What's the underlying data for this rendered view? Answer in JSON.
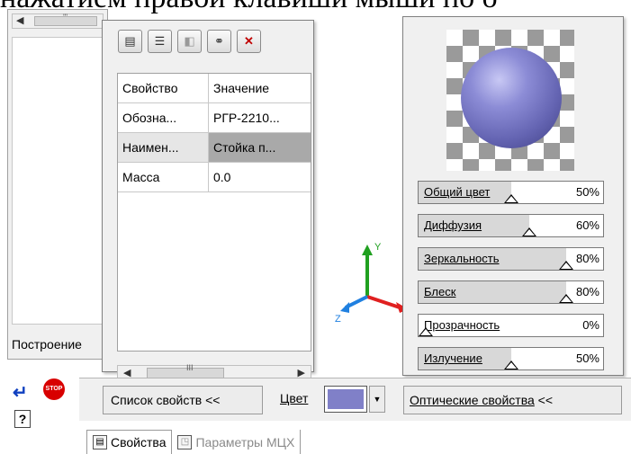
{
  "heading": "нажатием правой клавиши мыши по о",
  "left_panel": {
    "label": "Построение",
    "scroll_grip": "'''"
  },
  "props_panel": {
    "toolbar": [
      {
        "name": "properties-sheet-icon",
        "glyph": "▤"
      },
      {
        "name": "list-icon",
        "glyph": "☰"
      },
      {
        "name": "library-icon",
        "glyph": "◧"
      },
      {
        "name": "link-icon",
        "glyph": "⚭"
      },
      {
        "name": "delete-icon",
        "glyph": "✕"
      }
    ],
    "header": {
      "key": "Свойство",
      "value": "Значение"
    },
    "rows": [
      {
        "key": "Обозна...",
        "value": "РГР-2210..."
      },
      {
        "key": "Наимен...",
        "value": "Стойка п..."
      },
      {
        "key": "Масса",
        "value": "0.0"
      }
    ],
    "scroll_grip": "III"
  },
  "optics_panel": {
    "sliders": [
      {
        "label": "Общий цвет",
        "value": "50%",
        "level": 0.5
      },
      {
        "label": "Диффузия",
        "value": "60%",
        "level": 0.6
      },
      {
        "label": "Зеркальность",
        "value": "80%",
        "level": 0.8
      },
      {
        "label": "Блеск",
        "value": "80%",
        "level": 0.8
      },
      {
        "label": "Прозрачность",
        "value": "0%",
        "level": 0.0
      },
      {
        "label": "Излучение",
        "value": "50%",
        "level": 0.5
      }
    ]
  },
  "axes": {
    "y": "Y",
    "z": "Z"
  },
  "bottom_bar": {
    "list_button": "Список свойств  <<",
    "color_label": "Цвет",
    "color_value": "#8080c8",
    "optics_button": "Оптические свойства",
    "optics_chevron": "<<"
  },
  "stop_label": "STOP",
  "help_glyph": "?",
  "tabs": [
    {
      "label": "Свойства",
      "active": true
    },
    {
      "label": "Параметры МЦХ",
      "active": false
    }
  ],
  "colors": {
    "sphere": "#8080c8",
    "selected_row": "#a9a9a9",
    "axis_x": "#e02020",
    "axis_y": "#20a020",
    "axis_z": "#2080e0"
  }
}
